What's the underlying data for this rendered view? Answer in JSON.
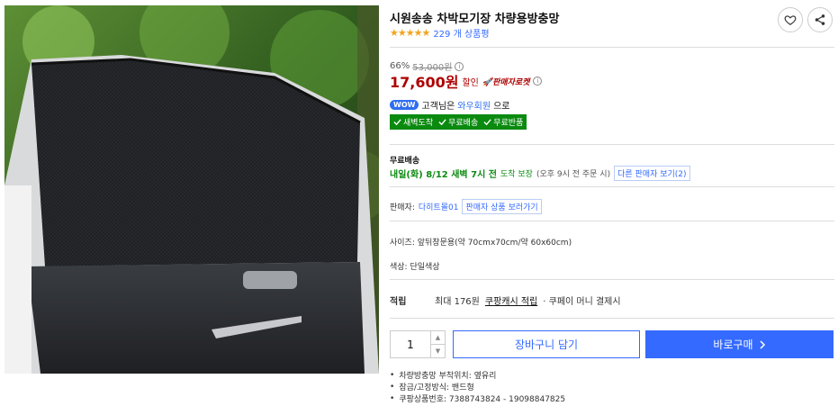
{
  "product": {
    "title": "시원송송 차박모기장 차량용방충망",
    "stars": "★★★★★",
    "review_count": "229 개 상품평"
  },
  "icons": {
    "heart": "heart-icon",
    "share": "share-icon",
    "check": "check-icon",
    "chevron": "chevron-right-icon"
  },
  "price": {
    "discount": "66%",
    "original": "53,000원",
    "info_mark": "i",
    "sale": "17,600원",
    "sale_label": "할인",
    "rocket": "🚀판매자로켓"
  },
  "wow": {
    "badge": "WOW",
    "text_before": "고객님은",
    "member": "와우회원",
    "text_after": "으로"
  },
  "benefits": [
    "새벽도착",
    "무료배송",
    "무료반품"
  ],
  "shipping": {
    "label": "무료배송",
    "date": "내일(화) 8/12 새벽 7시 전",
    "guarantee": "도착 보장",
    "note": "(오후 9시 전 주문 시)",
    "other_sellers": "다른 판매자 보기(2)"
  },
  "seller": {
    "label": "판매자:",
    "name": "다히트몰01",
    "link": "판매자 상품 보러가기"
  },
  "options": {
    "size": "사이즈: 앞뒤창문용(약 70cmx70cm/약 60x60cm)",
    "color": "색상: 단일색상"
  },
  "cash": {
    "label": "적립",
    "max": "최대 176원",
    "link": "쿠팡캐시 적립",
    "rest": "· 쿠페이 머니 결제시"
  },
  "purchase": {
    "quantity": "1",
    "up": "▲",
    "down": "▼",
    "cart": "장바구니 담기",
    "buy": "바로구매"
  },
  "specs": [
    "차량방충망 부착위치: 옆유리",
    "잠금/고정방식: 밴드형",
    "쿠팡상품번호: 7388743824 - 19098847825"
  ],
  "colors": {
    "accent": "#346aff",
    "price": "#ae0000",
    "green": "#0b8a10",
    "star": "#f1a51f"
  }
}
